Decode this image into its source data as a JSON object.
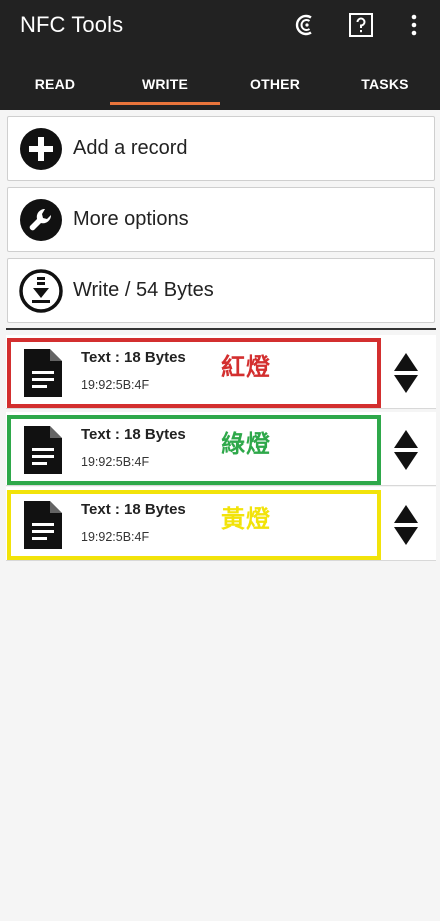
{
  "app": {
    "title": "NFC Tools"
  },
  "toolbar": {
    "icons": [
      "nfc-c-icon",
      "help-icon",
      "more-vert-icon"
    ]
  },
  "tabs": [
    {
      "label": "READ",
      "active": false
    },
    {
      "label": "WRITE",
      "active": true
    },
    {
      "label": "OTHER",
      "active": false
    },
    {
      "label": "TASKS",
      "active": false
    }
  ],
  "actions": [
    {
      "label": "Add a record",
      "icon": "add-circle-icon"
    },
    {
      "label": "More options",
      "icon": "wrench-icon"
    },
    {
      "label": "Write / 54 Bytes",
      "icon": "write-download-icon"
    }
  ],
  "records": [
    {
      "title": "Text : 18 Bytes",
      "id": "19:92:5B:4F",
      "annotation": "紅燈",
      "highlight_color": "#d32f2f"
    },
    {
      "title": "Text : 18 Bytes",
      "id": "19:92:5B:4F",
      "annotation": "綠燈",
      "highlight_color": "#2ea84a"
    },
    {
      "title": "Text : 18 Bytes",
      "id": "19:92:5B:4F",
      "annotation": "黃燈",
      "highlight_color": "#f2e30a"
    }
  ],
  "colors": {
    "appbar_bg": "#222222",
    "tab_indicator": "#e8743b",
    "background": "#f5f5f5"
  }
}
